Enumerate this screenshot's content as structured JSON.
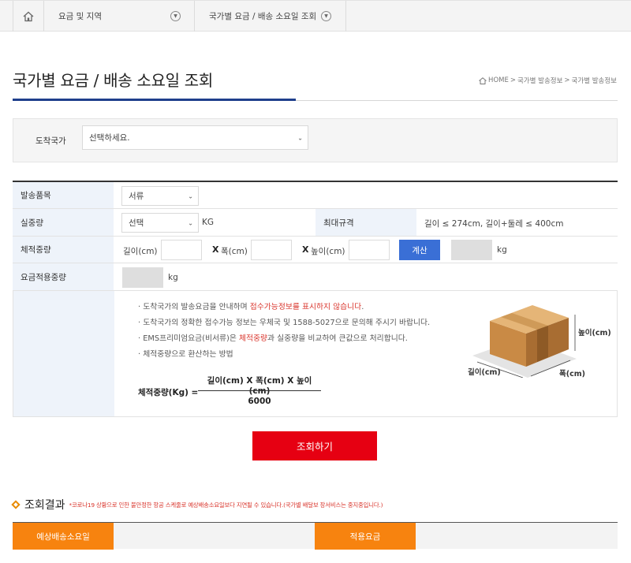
{
  "nav": {
    "item1": "요금 및 지역",
    "item2": "국가별 요금 / 배송 소요일 조회"
  },
  "page": {
    "title": "국가별 요금 / 배송 소요일 조회",
    "breadcrumb": [
      "HOME",
      "국가별 발송정보",
      "국가별 발송정보"
    ]
  },
  "destination": {
    "label": "도착국가",
    "select_value": "선택하세요."
  },
  "form": {
    "item_label": "발송품목",
    "item_value": "서류",
    "weight_label": "실중량",
    "weight_value": "선택",
    "weight_unit": "KG",
    "maxsize_label": "최대규격",
    "maxsize_value": "길이 ≤ 274cm, 길이+둘레 ≤ 400cm",
    "vol_label": "체적중량",
    "length_label": "길이(cm)",
    "width_label": "폭(cm)",
    "height_label": "높이(cm)",
    "x_mark": "X",
    "calc_button": "계산",
    "vol_unit": "kg",
    "applied_label": "요금적용중량",
    "applied_unit": "kg"
  },
  "info": {
    "line1_a": "· 도착국가의 발송요금을 안내하며 ",
    "line1_red": "접수가능정보를 표시하지 않습니다",
    "line1_b": ".",
    "line2": "· 도착국가의 정확한 접수가능 정보는 우체국 및 1588-5027으로 문의해 주시기 바랍니다.",
    "line3_a": "· EMS프리미엄요금(비서류)은 ",
    "line3_red": "체적중량",
    "line3_b": "과 실중량을 비교하여 큰값으로 처리합니다.",
    "line4": "· 체적중량으로 환산하는 방법",
    "formula_label": "체적중량(Kg) =",
    "formula_numerator": "길이(cm) X 폭(cm) X 높이(cm)",
    "formula_denominator": "6000",
    "box_height": "높이(cm)",
    "box_length": "길이(cm)",
    "box_width": "폭(cm)"
  },
  "submit_button": "조회하기",
  "result": {
    "title": "조회결과",
    "note": "*코로나19 상황으로 인한 불안정한 항공 스케줄로 예상배송소요일보다 지연될 수 있습니다.(국가별 배달보 장서비스는 중지중입니다.)",
    "col1": "예상배송소요일",
    "col2": "적용요금"
  }
}
